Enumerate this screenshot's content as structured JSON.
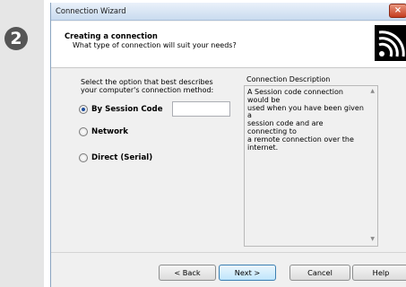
{
  "step": {
    "number": "2"
  },
  "window": {
    "title": "Connection Wizard",
    "close_label": "×"
  },
  "header": {
    "title": "Creating a connection",
    "subtitle": "What type of connection will suit your needs?",
    "logo_icon": "signal-waves-icon"
  },
  "main": {
    "prompt_line1": "Select the option that best describes",
    "prompt_line2": "your computer's connection method:",
    "options": [
      {
        "label": "By Session Code",
        "selected": true
      },
      {
        "label": "Network",
        "selected": false
      },
      {
        "label": "Direct (Serial)",
        "selected": false
      }
    ],
    "session_code_value": ""
  },
  "description": {
    "title": "Connection Description",
    "lines": [
      "A Session code connection would be",
      "used when you have been given a",
      "session code and are connecting to",
      "a remote connection over the",
      "internet."
    ],
    "scroll_up_label": "▲",
    "scroll_down_label": "▼"
  },
  "buttons": {
    "back": "< Back",
    "next": "Next >",
    "cancel": "Cancel",
    "help": "Help"
  }
}
